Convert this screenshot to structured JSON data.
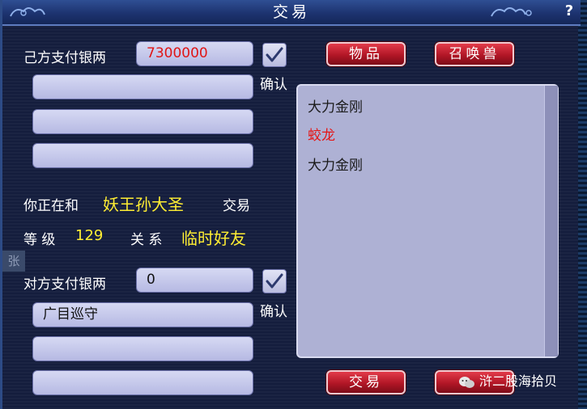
{
  "window": {
    "title": "交易",
    "help_label": "?"
  },
  "self": {
    "pay_label": "己方支付银两",
    "pay_value": "7300000",
    "confirm_label": "确认",
    "slots": [
      "",
      "",
      ""
    ]
  },
  "partner": {
    "trading_prefix": "你正在和",
    "name": "妖王孙大圣",
    "trading_suffix": "交易",
    "level_label": "等 级",
    "level_value": "129",
    "relation_label": "关 系",
    "relation_value": "临时好友",
    "pay_label": "对方支付银两",
    "pay_value": "0",
    "confirm_label": "确认",
    "slots": [
      "广目巡守",
      "",
      ""
    ]
  },
  "tabs": {
    "items_label": "物品",
    "summon_label": "召唤兽"
  },
  "item_list": [
    {
      "name": "大力金刚",
      "color": "#1a1a1a"
    },
    {
      "name": "蛟龙",
      "color": "#e51616"
    },
    {
      "name": "大力金刚",
      "color": "#1a1a1a"
    }
  ],
  "actions": {
    "trade_label": "交易"
  },
  "stray_text": "张",
  "watermark": "浒二股海拾贝",
  "colors": {
    "accent_red": "#e01515",
    "highlight_yellow": "#ffee33",
    "button_red": "#b21626",
    "field_lavender": "#c6c9ec"
  }
}
